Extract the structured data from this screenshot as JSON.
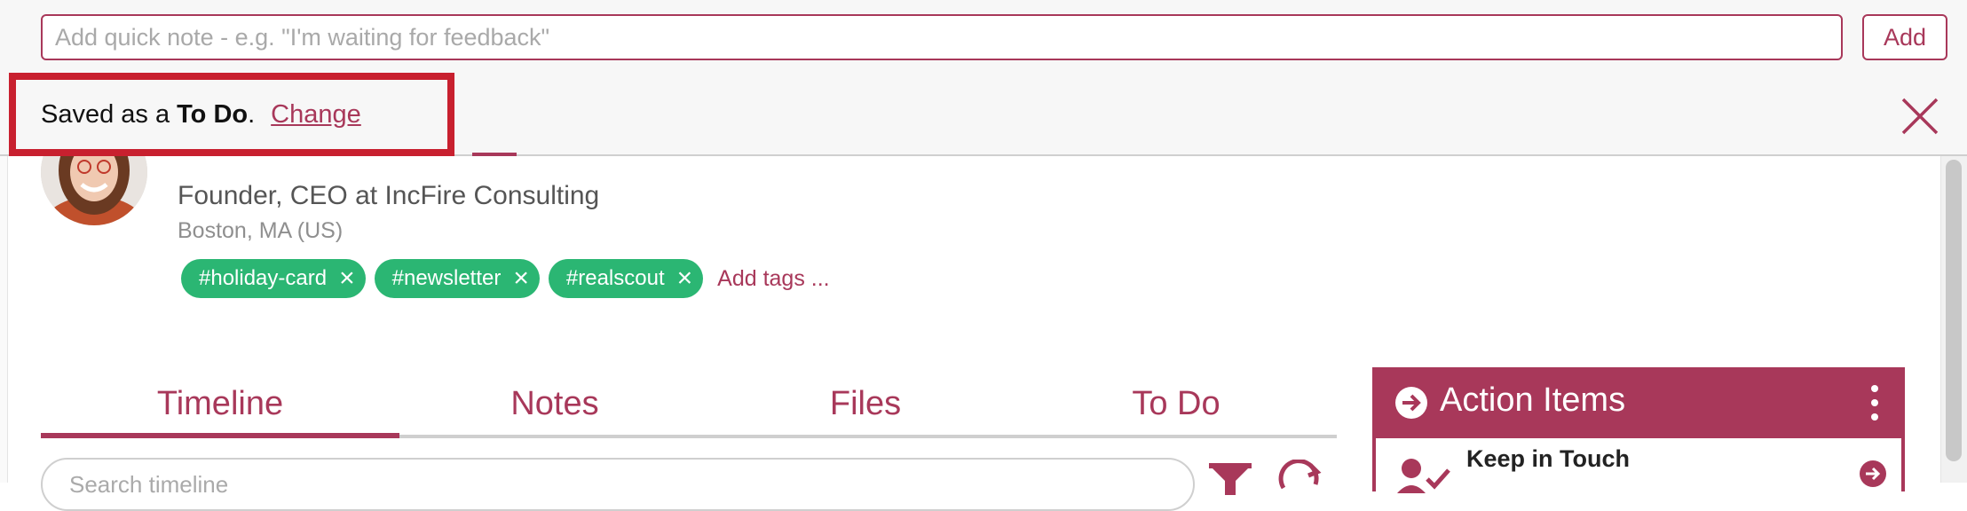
{
  "quick_note": {
    "placeholder": "Add quick note - e.g. \"I'm waiting for feedback\"",
    "value": "",
    "add_label": "Add"
  },
  "saved_notice": {
    "prefix": "Saved as a",
    "type": "To Do",
    "suffix": ".",
    "change_label": "Change"
  },
  "contact": {
    "title": "Founder, CEO at IncFire Consulting",
    "location": "Boston, MA (US)",
    "tags": [
      "#holiday-card",
      "#newsletter",
      "#realscout"
    ],
    "add_tags_label": "Add tags ..."
  },
  "tabs": [
    {
      "label": "Timeline",
      "active": true
    },
    {
      "label": "Notes",
      "active": false
    },
    {
      "label": "Files",
      "active": false
    },
    {
      "label": "To Do",
      "active": false
    }
  ],
  "timeline_search": {
    "placeholder": "Search timeline"
  },
  "action_items": {
    "title": "Action Items",
    "first_item": "Keep in Touch"
  },
  "colors": {
    "brand": "#a8385a",
    "tag_green": "#2bb673",
    "highlight_red": "#c8202f"
  }
}
